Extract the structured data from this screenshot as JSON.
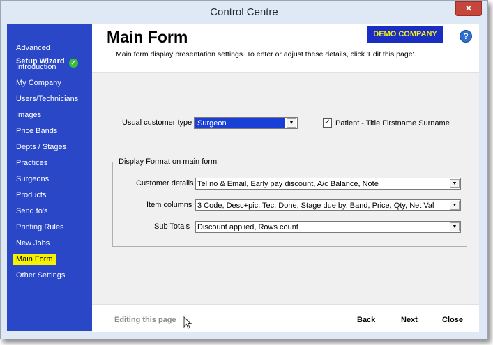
{
  "window": {
    "title": "Control Centre",
    "close_icon": "close-icon"
  },
  "sidebar": {
    "wizard_line1": "Advanced",
    "wizard_line2": "Setup Wizard",
    "items": [
      {
        "label": "Introduction"
      },
      {
        "label": "My Company"
      },
      {
        "label": "Users/Technicians"
      },
      {
        "label": "Images"
      },
      {
        "label": "Price Bands"
      },
      {
        "label": "Depts / Stages"
      },
      {
        "label": "Practices"
      },
      {
        "label": "Surgeons"
      },
      {
        "label": "Products"
      },
      {
        "label": "Send to's"
      },
      {
        "label": "Printing Rules"
      },
      {
        "label": "New Jobs"
      },
      {
        "label": "Main Form"
      },
      {
        "label": "Other Settings"
      }
    ],
    "active": "Main Form"
  },
  "header": {
    "title": "Main Form",
    "description": "Main form display presentation settings. To enter or adjust these details, click 'Edit this page'.",
    "badge": "DEMO COMPANY",
    "help_glyph": "?"
  },
  "form": {
    "customer_type_label": "Usual customer type",
    "customer_type_value": "Surgeon",
    "patient_checkbox_label": "Patient - Title Firstname Surname",
    "patient_checked": true,
    "group_title": "Display Format on main form",
    "customer_details_label": "Customer details",
    "customer_details_value": "Tel no & Email, Early pay discount, A/c Balance, Note",
    "item_columns_label": "Item columns",
    "item_columns_value": "3 Code, Desc+pic, Tec, Done, Stage due by, Band, Price, Qty, Net Val",
    "sub_totals_label": "Sub Totals",
    "sub_totals_value": "Discount applied, Rows count"
  },
  "footer": {
    "edit_label": "Editing this page",
    "back": "Back",
    "next": "Next",
    "close": "Close"
  },
  "colors": {
    "sidebar": "#2a47c8",
    "active_item": "#f7f300",
    "badge_bg": "#1b2ec4",
    "badge_fg": "#f2ee17"
  }
}
